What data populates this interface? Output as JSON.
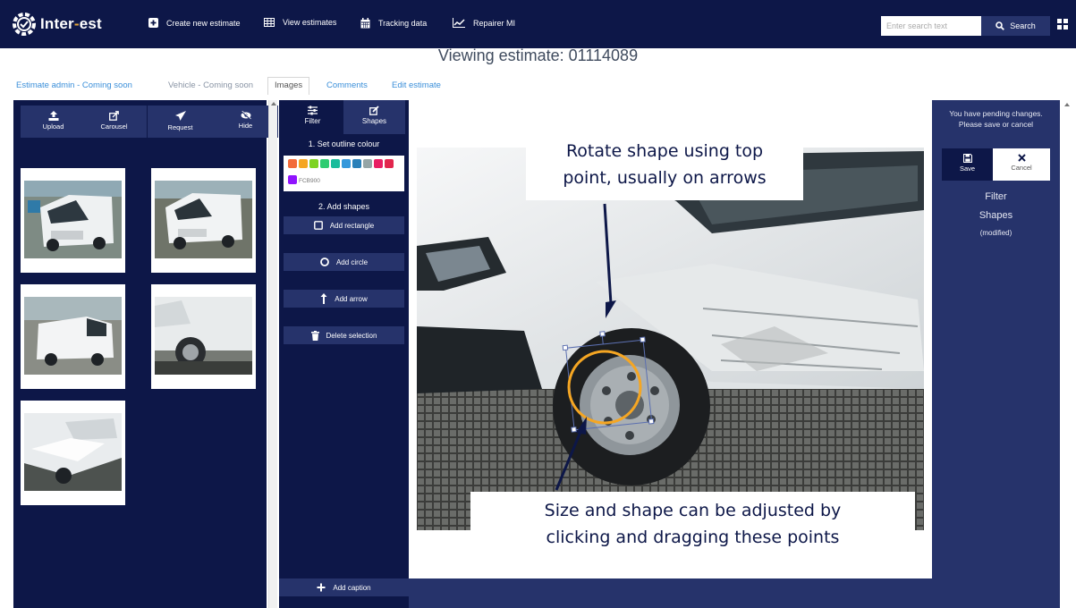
{
  "app": {
    "logo_main": "Inter",
    "logo_dash": "-",
    "logo_end": "est"
  },
  "nav": {
    "items": [
      {
        "label": "Create new estimate",
        "icon": "plus-square-icon"
      },
      {
        "label": "View estimates",
        "icon": "table-icon"
      },
      {
        "label": "Tracking data",
        "icon": "calendar-icon"
      },
      {
        "label": "Repairer MI",
        "icon": "line-chart-icon"
      }
    ]
  },
  "search": {
    "placeholder": "Enter search text",
    "button_label": "Search"
  },
  "page": {
    "title": "Viewing estimate: 01114089"
  },
  "tabs": [
    {
      "label": "Estimate admin - Coming soon",
      "state": "link"
    },
    {
      "label": "Vehicle - Coming soon",
      "state": "muted"
    },
    {
      "label": "Images",
      "state": "active"
    },
    {
      "label": "Comments",
      "state": "link"
    },
    {
      "label": "Edit estimate",
      "state": "link"
    }
  ],
  "gallery": {
    "tools": [
      {
        "label": "Upload",
        "icon": "upload-icon"
      },
      {
        "label": "Carousel",
        "icon": "external-edit-icon"
      },
      {
        "label": "Request",
        "icon": "paper-plane-icon"
      },
      {
        "label": "Hide",
        "icon": "eye-slash-icon"
      }
    ],
    "thumbnail_count": 5
  },
  "editor_tools": {
    "tabs": [
      {
        "label": "Filter",
        "icon": "sliders-icon"
      },
      {
        "label": "Shapes",
        "icon": "edit-icon"
      }
    ],
    "step1_label": "1. Set outline colour",
    "colours": [
      "#f26b3a",
      "#f5a623",
      "#7ed321",
      "#2ecc71",
      "#1abc9c",
      "#3498db",
      "#2980b9",
      "#95a5a6",
      "#e91e63",
      "#e2264d",
      "#9013fe"
    ],
    "selected_hex": "FCB900",
    "step2_label": "2. Add shapes",
    "buttons": [
      {
        "label": "Add rectangle",
        "icon": "square-icon"
      },
      {
        "label": "Add circle",
        "icon": "circle-icon"
      },
      {
        "label": "Add arrow",
        "icon": "arrow-up-icon"
      },
      {
        "label": "Delete selection",
        "icon": "trash-icon"
      }
    ],
    "caption_label": "Add caption"
  },
  "right_panel": {
    "pending_line1": "You have pending changes.",
    "pending_line2": "Please save or cancel",
    "save_label": "Save",
    "cancel_label": "Cancel",
    "filter_label": "Filter",
    "shapes_label": "Shapes",
    "modified_label": "(modified)"
  },
  "annotations": {
    "rotate_line1": "Rotate shape using top",
    "rotate_line2": "point, usually on arrows",
    "resize_line1": "Size and shape can be adjusted by",
    "resize_line2": "clicking and dragging these points"
  },
  "colors": {
    "navy": "#0d1748",
    "panel_blue": "#26336b",
    "highlight_orange": "#f5a623",
    "link_blue": "#3b8fd9"
  }
}
